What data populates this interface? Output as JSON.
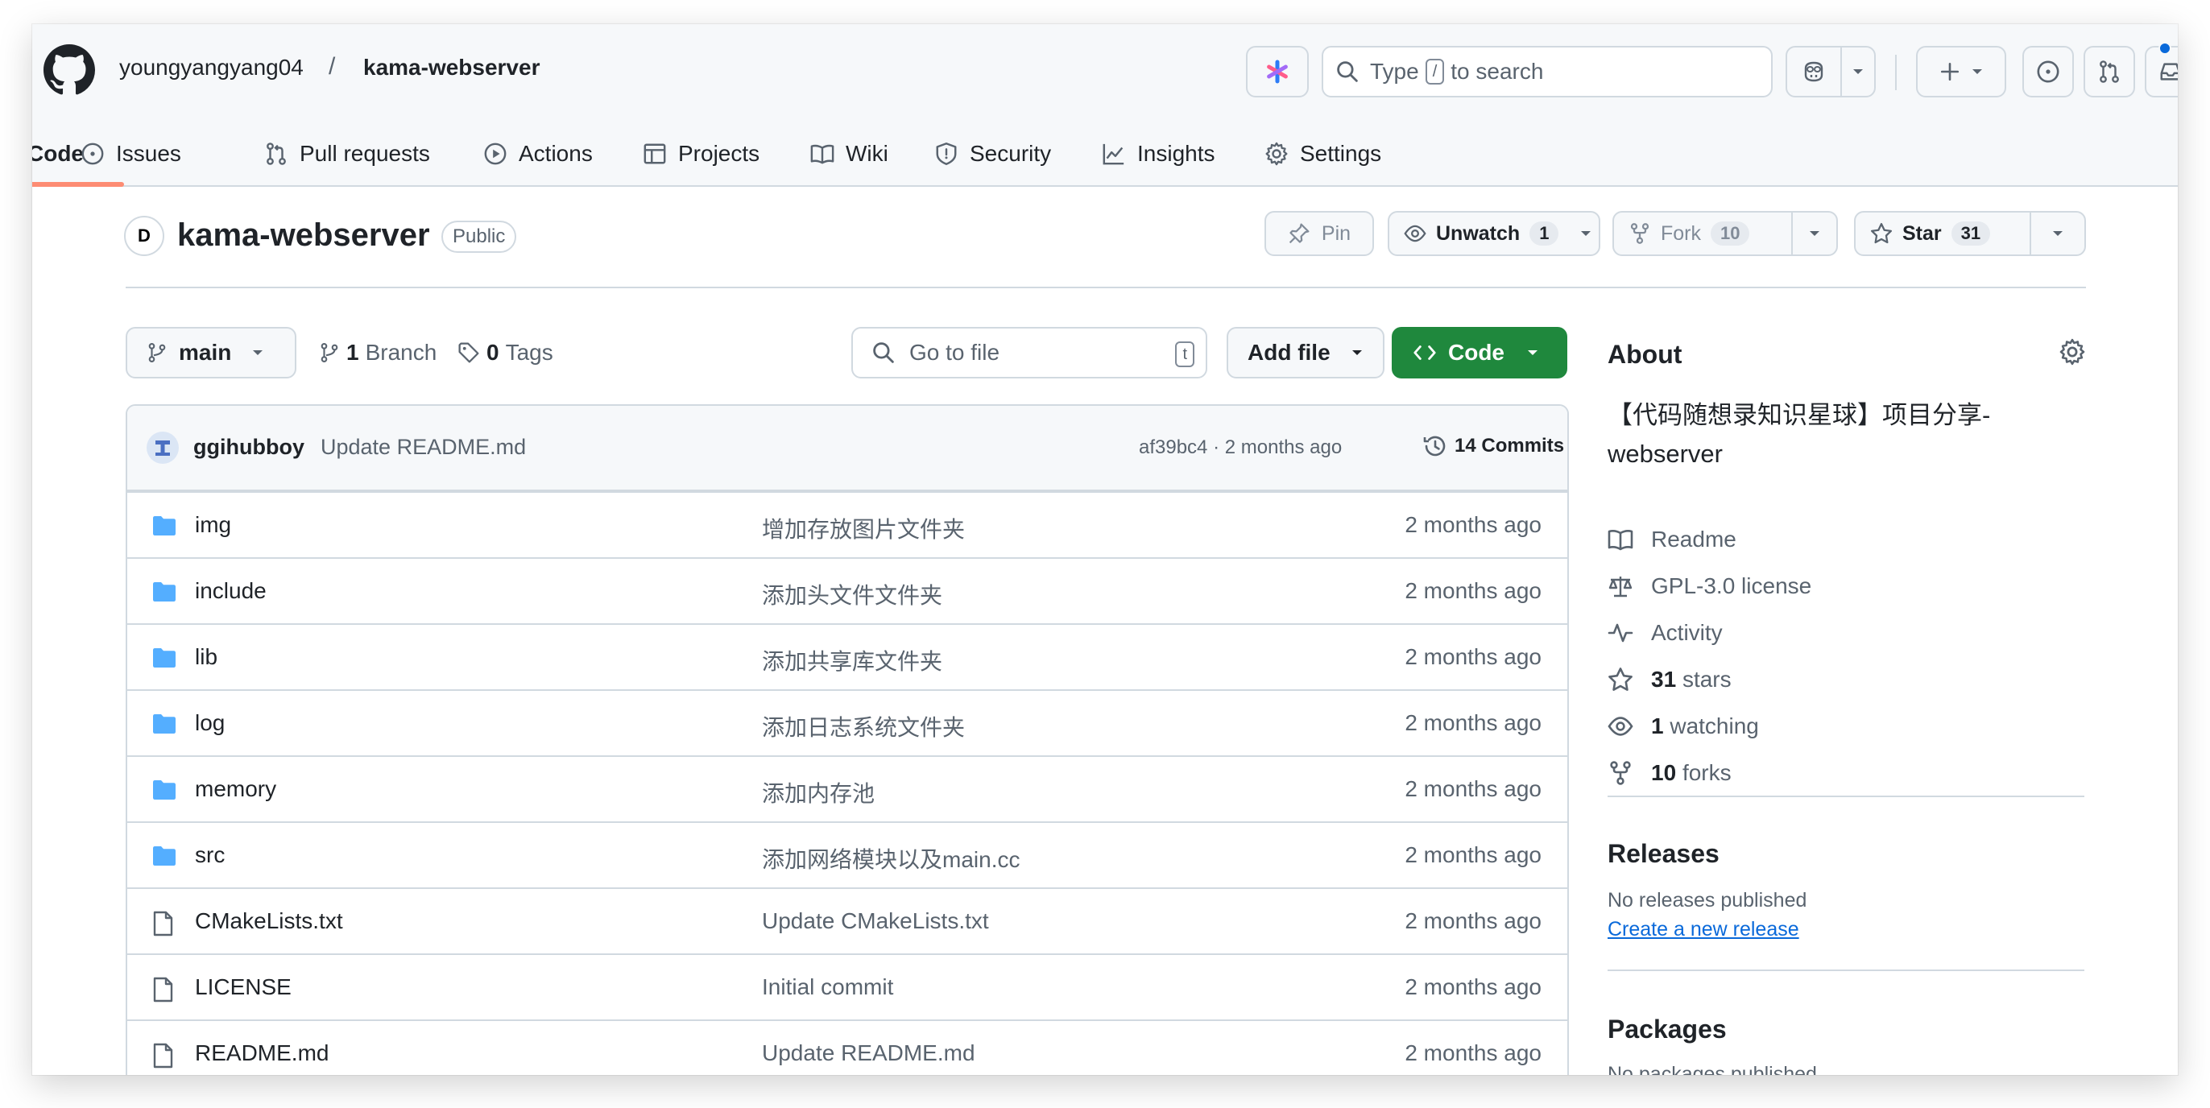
{
  "header": {
    "owner": "youngyangyang04",
    "separator": "/",
    "repo": "kama-webserver",
    "search_placeholder": "Type",
    "search_key": "/",
    "search_suffix": "to search"
  },
  "tabs": [
    {
      "label": "Code",
      "icon": "code-icon",
      "active": true
    },
    {
      "label": "Issues",
      "icon": "issue-icon"
    },
    {
      "label": "Pull requests",
      "icon": "pull-request-icon"
    },
    {
      "label": "Actions",
      "icon": "play-icon"
    },
    {
      "label": "Projects",
      "icon": "table-icon"
    },
    {
      "label": "Wiki",
      "icon": "book-icon"
    },
    {
      "label": "Security",
      "icon": "shield-icon"
    },
    {
      "label": "Insights",
      "icon": "graph-icon"
    },
    {
      "label": "Settings",
      "icon": "gear-icon"
    }
  ],
  "repo_header": {
    "avatar_letter": "D",
    "title": "kama-webserver",
    "visibility": "Public",
    "pin_label": "Pin",
    "watch_label": "Unwatch",
    "watch_count": "1",
    "fork_label": "Fork",
    "fork_count": "10",
    "star_label": "Star",
    "star_count": "31"
  },
  "toolbar": {
    "branch": "main",
    "branches_count": "1",
    "branches_label": "Branch",
    "tags_count": "0",
    "tags_label": "Tags",
    "goto_placeholder": "Go to file",
    "goto_key": "t",
    "add_file": "Add file",
    "code": "Code"
  },
  "latest_commit": {
    "author": "ggihubboy",
    "message": "Update README.md",
    "meta": "af39bc4 · 2 months ago",
    "commits": "14 Commits"
  },
  "files": [
    {
      "name": "img",
      "type": "folder",
      "message": "增加存放图片文件夹",
      "date": "2 months ago"
    },
    {
      "name": "include",
      "type": "folder",
      "message": "添加头文件文件夹",
      "date": "2 months ago"
    },
    {
      "name": "lib",
      "type": "folder",
      "message": "添加共享库文件夹",
      "date": "2 months ago"
    },
    {
      "name": "log",
      "type": "folder",
      "message": "添加日志系统文件夹",
      "date": "2 months ago"
    },
    {
      "name": "memory",
      "type": "folder",
      "message": "添加内存池",
      "date": "2 months ago"
    },
    {
      "name": "src",
      "type": "folder",
      "message": "添加网络模块以及main.cc",
      "date": "2 months ago"
    },
    {
      "name": "CMakeLists.txt",
      "type": "file",
      "message": "Update CMakeLists.txt",
      "date": "2 months ago"
    },
    {
      "name": "LICENSE",
      "type": "file",
      "message": "Initial commit",
      "date": "2 months ago"
    },
    {
      "name": "README.md",
      "type": "file",
      "message": "Update README.md",
      "date": "2 months ago"
    }
  ],
  "about": {
    "heading": "About",
    "description": "【代码随想录知识星球】项目分享-webserver",
    "readme": "Readme",
    "license": "GPL-3.0 license",
    "activity": "Activity",
    "stars_count": "31",
    "stars_label": "stars",
    "watching_count": "1",
    "watching_label": "watching",
    "forks_count": "10",
    "forks_label": "forks"
  },
  "releases": {
    "heading": "Releases",
    "none": "No releases published",
    "create": "Create a new release"
  },
  "packages": {
    "heading": "Packages",
    "none": "No packages published"
  },
  "colors": {
    "accent_green": "#1f883d",
    "link_blue": "#0969da",
    "tab_underline": "#fd8c73",
    "folder_blue": "#54aeff"
  }
}
